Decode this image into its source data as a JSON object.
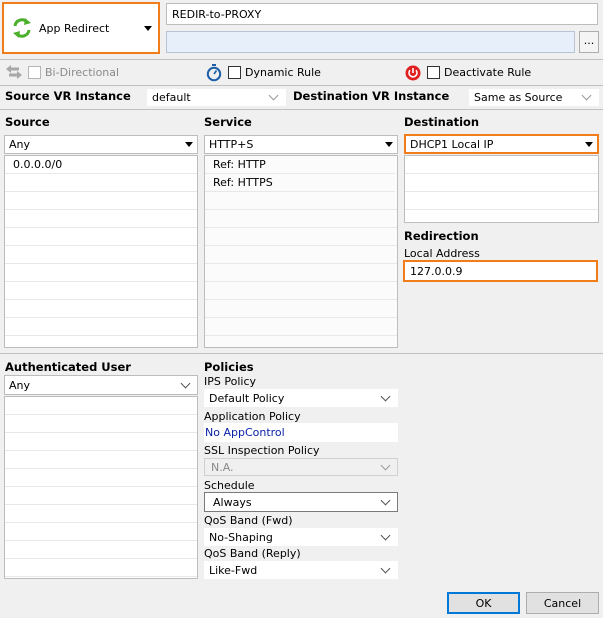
{
  "action": {
    "label": "App Redirect",
    "icon": "redirect-arrows-icon"
  },
  "rule_name": {
    "value": "REDIR-to-PROXY"
  },
  "comment": {
    "value": "",
    "browse_label": "..."
  },
  "options": {
    "bidirectional": {
      "label": "Bi-Directional",
      "checked": false,
      "enabled": false
    },
    "dynamic_rule": {
      "label": "Dynamic Rule",
      "checked": false
    },
    "deactivate_rule": {
      "label": "Deactivate Rule",
      "checked": false
    }
  },
  "vr": {
    "source_label": "Source VR Instance",
    "source_value": "default",
    "dest_label": "Destination VR Instance",
    "dest_value": "Same as Source"
  },
  "source": {
    "heading": "Source",
    "selected": "Any",
    "items": [
      "0.0.0.0/0"
    ]
  },
  "service": {
    "heading": "Service",
    "selected": "HTTP+S",
    "items": [
      "Ref: HTTP",
      "Ref: HTTPS"
    ]
  },
  "destination": {
    "heading": "Destination",
    "selected": "DHCP1 Local IP",
    "items": []
  },
  "redirection": {
    "heading": "Redirection",
    "local_address_label": "Local Address",
    "local_address_value": "127.0.0.9"
  },
  "auth_user": {
    "heading": "Authenticated User",
    "selected": "Any"
  },
  "policies": {
    "heading": "Policies",
    "ips_label": "IPS Policy",
    "ips_value": "Default Policy",
    "app_label": "Application Policy",
    "app_value": "No AppControl",
    "ssl_label": "SSL Inspection Policy",
    "ssl_value": "N.A.",
    "schedule_label": "Schedule",
    "schedule_value": "Always",
    "qos_fwd_label": "QoS Band (Fwd)",
    "qos_fwd_value": "No-Shaping",
    "qos_reply_label": "QoS Band (Reply)",
    "qos_reply_value": "Like-Fwd"
  },
  "buttons": {
    "ok": "OK",
    "cancel": "Cancel"
  },
  "colors": {
    "highlight": "#f07d1a",
    "link_blue": "#0a24a8",
    "power_red": "#e02020",
    "redirect_green": "#4caf2a"
  }
}
